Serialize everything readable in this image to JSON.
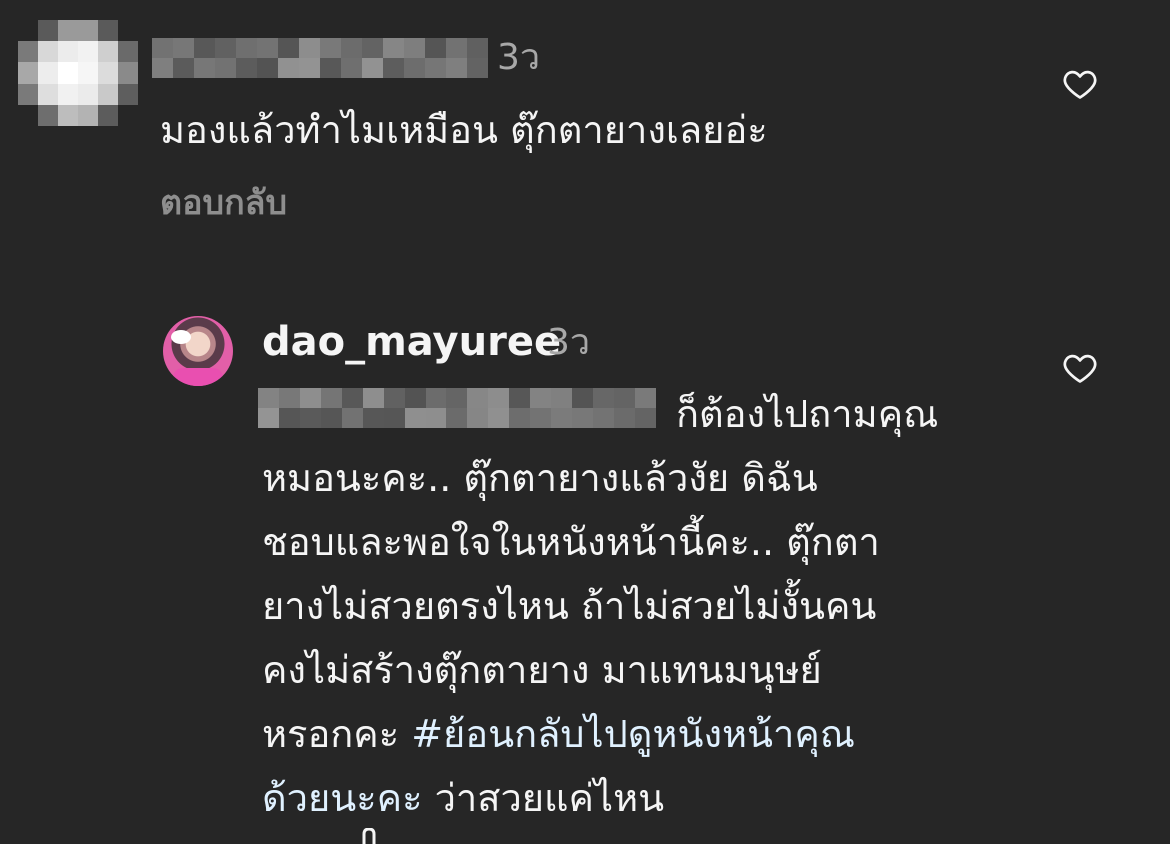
{
  "comments": [
    {
      "username_redacted": true,
      "time": "3ว",
      "text": "มองแล้วทำไมเหมือน ตุ๊กตายางเลยอ่ะ",
      "reply_label": "ตอบกลับ",
      "like_icon": "heart-outline-icon"
    },
    {
      "username": "dao_mayuree",
      "time": "3ว",
      "mention_redacted": true,
      "text_lines": [
        "ก็ต้องไปถามคุณ",
        "หมอนะคะ.. ตุ๊กตายางแล้วงัย ดิฉัน",
        "ชอบและพอใจในหนังหน้านี้คะ.. ตุ๊กตา",
        "ยางไม่สวยตรงไหน ถ้าไม่สวยไม่งั้นคน",
        "คงไม่สร้างตุ๊กตายาง มาแทนมนุษย์",
        "หรอกคะ "
      ],
      "hashtag": "#ย้อนกลับไปดูหนังหน้าคุณ",
      "tail_line": "ด้วยนะคะ ว่าสวยแค่ไหน",
      "like_icon": "heart-outline-icon"
    }
  ],
  "colors": {
    "background": "#262626",
    "primary_text": "#f5f5f5",
    "secondary_text": "#a8a8a8",
    "reply_text": "#8e8e8e",
    "hashtag": "#e0f1ff"
  }
}
